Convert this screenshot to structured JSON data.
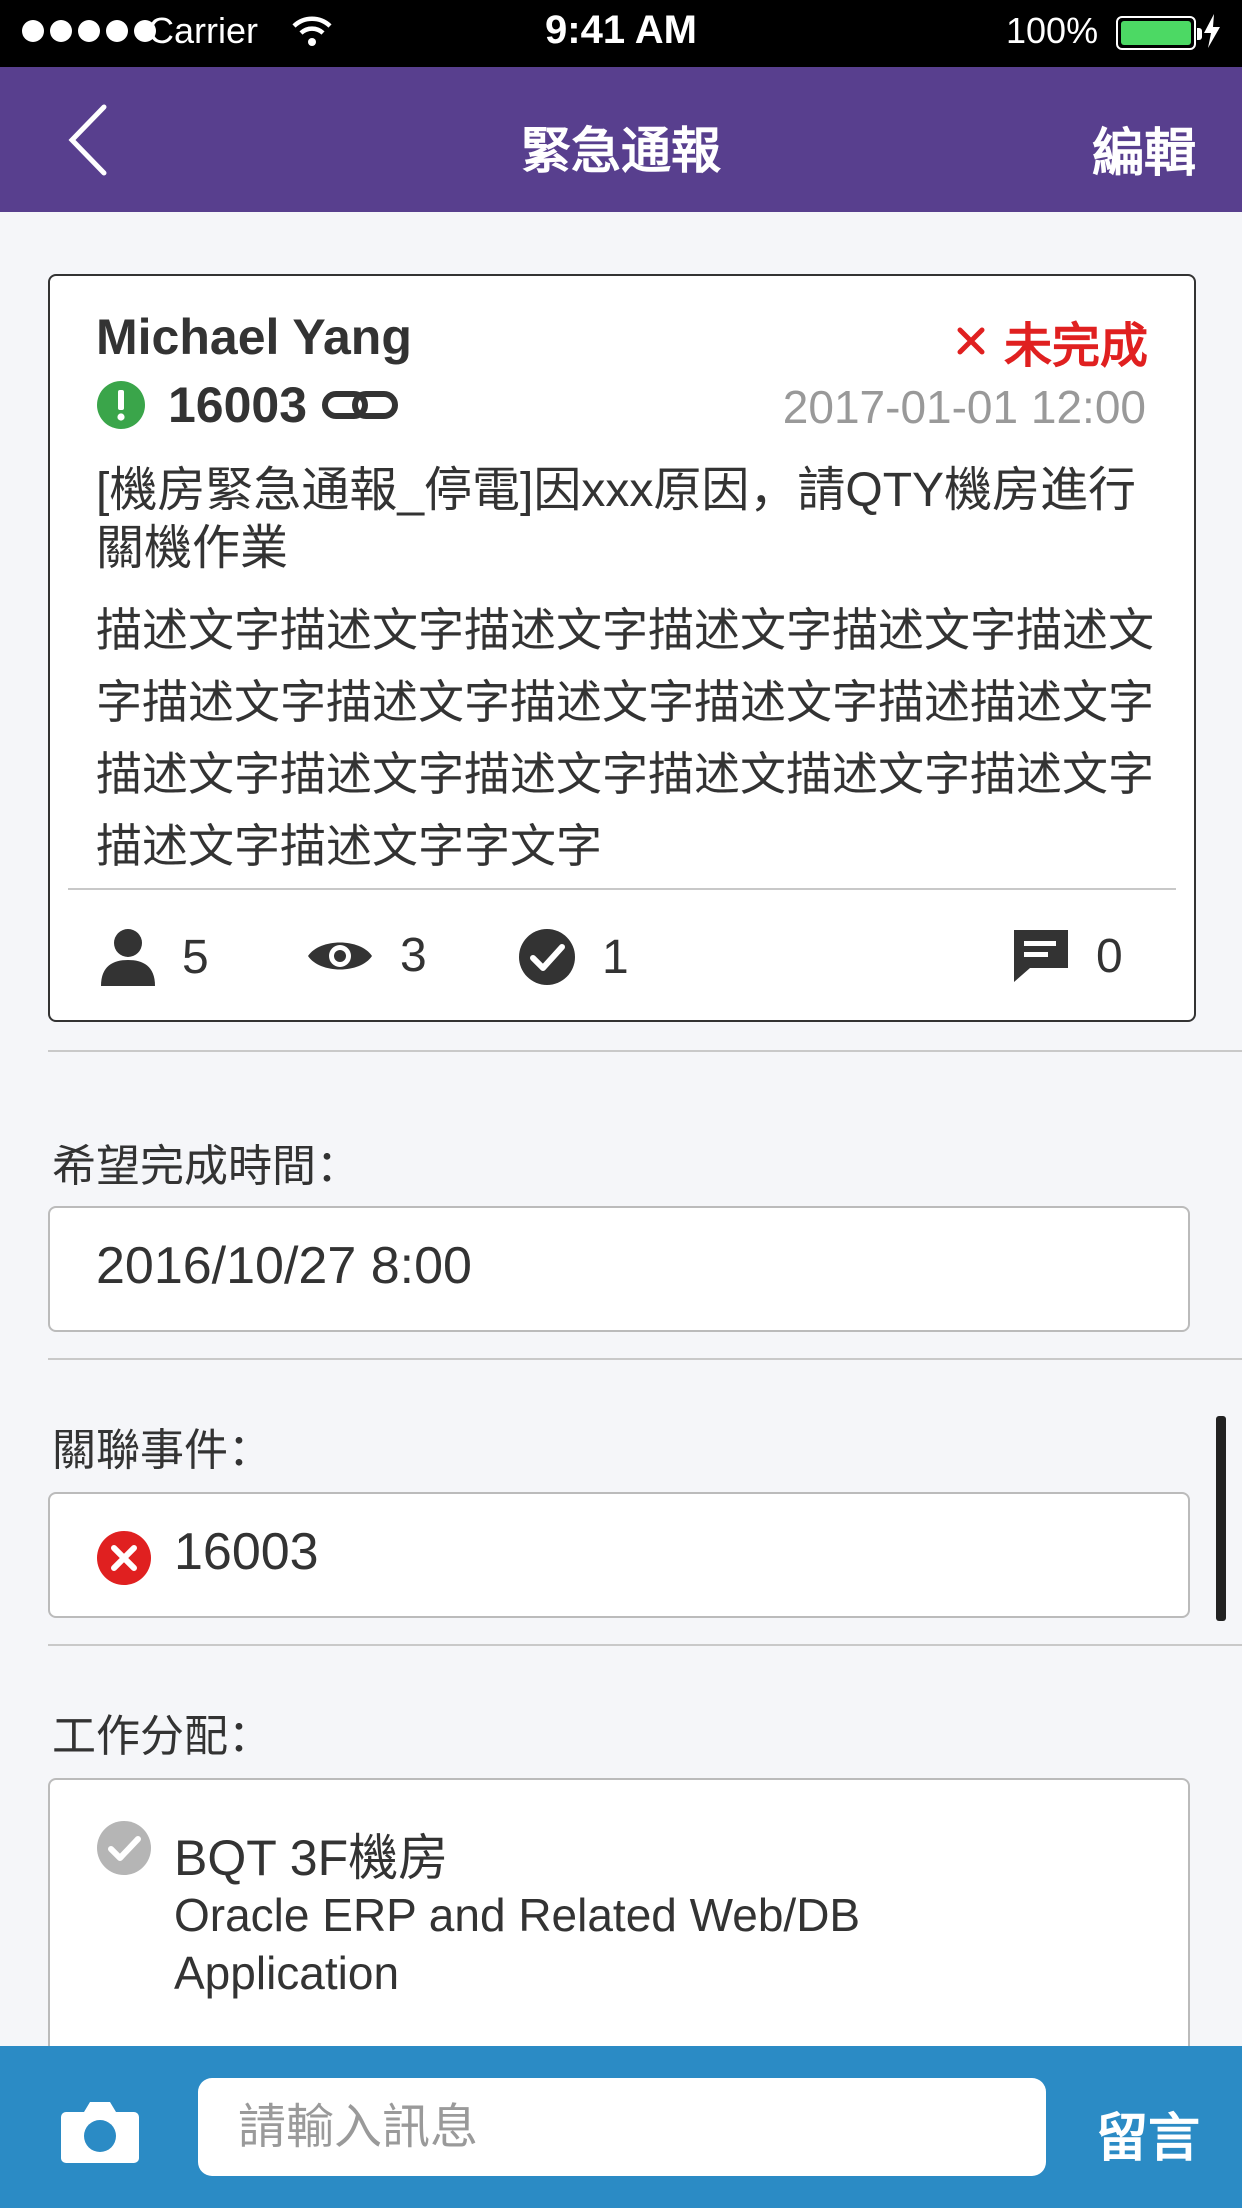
{
  "status_bar": {
    "carrier": "Carrier",
    "time": "9:41 AM",
    "battery": "100%"
  },
  "nav": {
    "title": "緊急通報",
    "edit_label": "編輯"
  },
  "card": {
    "name": "Michael Yang",
    "status": "未完成",
    "id": "16003",
    "datetime": "2017-01-01 12:00",
    "subject": "[機房緊急通報_停電]因xxx原因，請QTY機房進行關機作業",
    "description": "描述文字描述文字描述文字描述文字描述文字描述文字描述文字描述文字描述文字描述文字描述描述文字描述文字描述文字描述文字描述文描述文字描述文字描述文字描述文字字文字",
    "stats": {
      "people": "5",
      "views": "3",
      "done": "1",
      "comments": "0"
    }
  },
  "sections": {
    "due_label": "希望完成時間：",
    "due_value": "2016/10/27 8:00",
    "related_label": "關聯事件：",
    "related_value": "16003",
    "assign_label": "工作分配：",
    "assign_title": "BQT 3F機房",
    "assign_sub": "Oracle ERP and Related Web/DB Application"
  },
  "composer": {
    "placeholder": "請輸入訊息",
    "send_label": "留言"
  },
  "colors": {
    "nav": "#583f8e",
    "bottom": "#2b8bc5",
    "danger": "#e02020",
    "ok": "#3aa54a"
  }
}
